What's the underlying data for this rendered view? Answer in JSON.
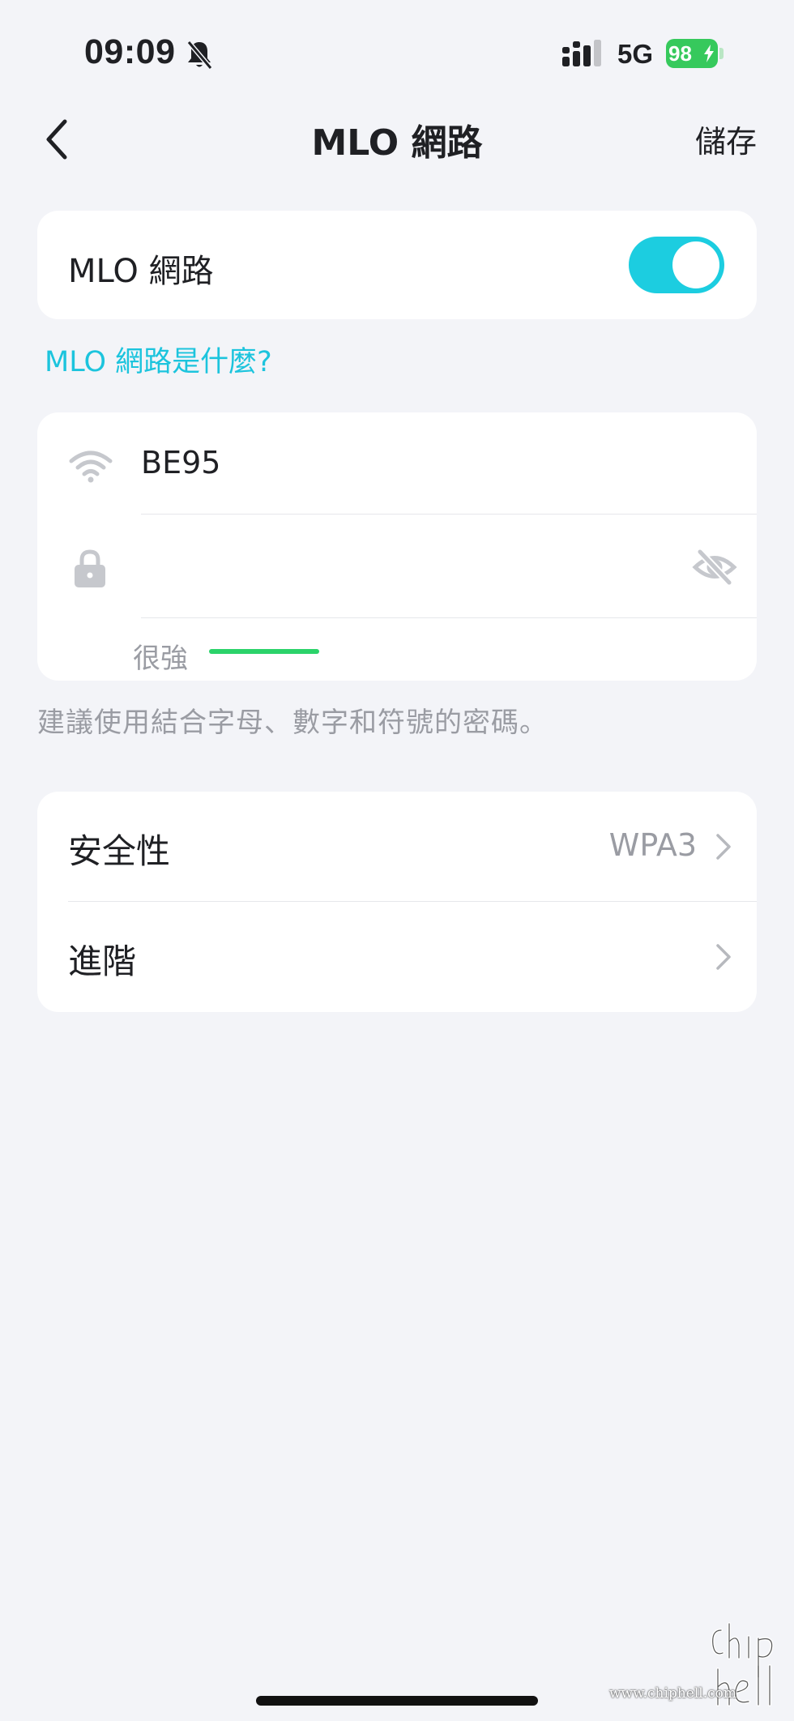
{
  "status_bar": {
    "time": "09:09",
    "network": "5G",
    "battery": "98"
  },
  "nav": {
    "title": "MLO 網路",
    "save_label": "儲存",
    "back_icon": "chevron-left-icon"
  },
  "mlo_toggle": {
    "label": "MLO 網路",
    "enabled": true,
    "accent_color": "#1ccde0"
  },
  "help_link": "MLO 網路是什麼?",
  "credentials": {
    "ssid": "BE95",
    "password_value": "",
    "strength_label": "很強",
    "strength_color": "#2bd36a",
    "wifi_icon": "wifi-icon",
    "lock_icon": "lock-icon",
    "visibility_icon": "eye-off-icon"
  },
  "hint": "建議使用結合字母、數字和符號的密碼。",
  "settings": [
    {
      "label": "安全性",
      "value": "WPA3"
    },
    {
      "label": "進階",
      "value": ""
    }
  ],
  "watermark": {
    "url": "www.chiphell.com",
    "logo": "chiphell"
  }
}
